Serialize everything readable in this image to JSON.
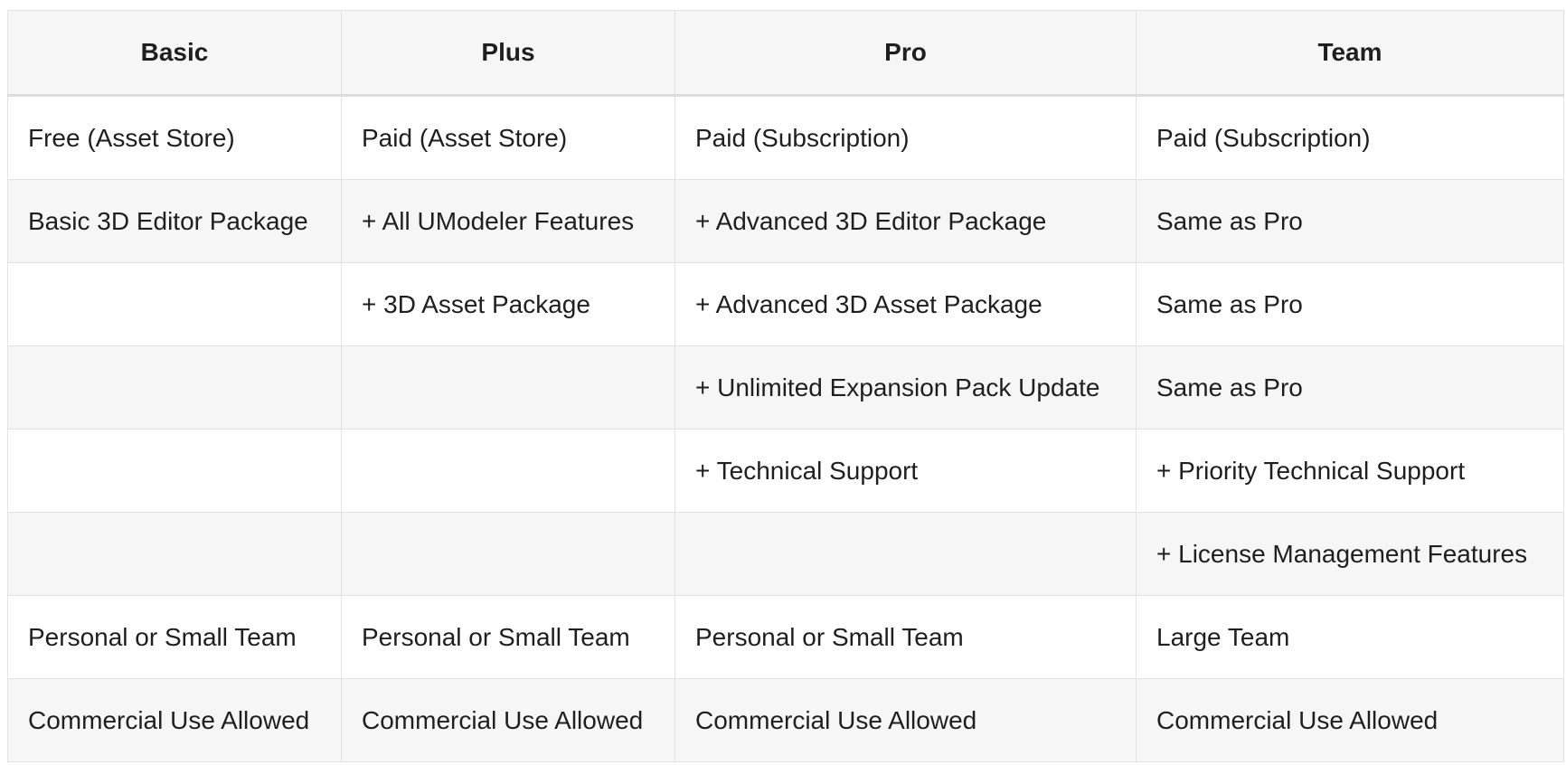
{
  "table": {
    "headers": [
      "Basic",
      "Plus",
      "Pro",
      "Team"
    ],
    "rows": [
      [
        "Free (Asset Store)",
        "Paid (Asset Store)",
        "Paid (Subscription)",
        "Paid (Subscription)"
      ],
      [
        "Basic 3D Editor Package",
        "+ All UModeler Features",
        "+ Advanced 3D Editor Package",
        "Same as Pro"
      ],
      [
        "",
        "+ 3D Asset Package",
        "+ Advanced 3D Asset Package",
        "Same as Pro"
      ],
      [
        "",
        "",
        "+ Unlimited Expansion Pack Update",
        "Same as Pro"
      ],
      [
        "",
        "",
        "+ Technical Support",
        "+ Priority Technical Support"
      ],
      [
        "",
        "",
        "",
        "+ License Management Features"
      ],
      [
        "Personal or Small Team",
        "Personal or Small Team",
        "Personal or Small Team",
        "Large Team"
      ],
      [
        "Commercial Use Allowed",
        "Commercial Use Allowed",
        "Commercial Use Allowed",
        "Commercial Use Allowed"
      ]
    ]
  }
}
